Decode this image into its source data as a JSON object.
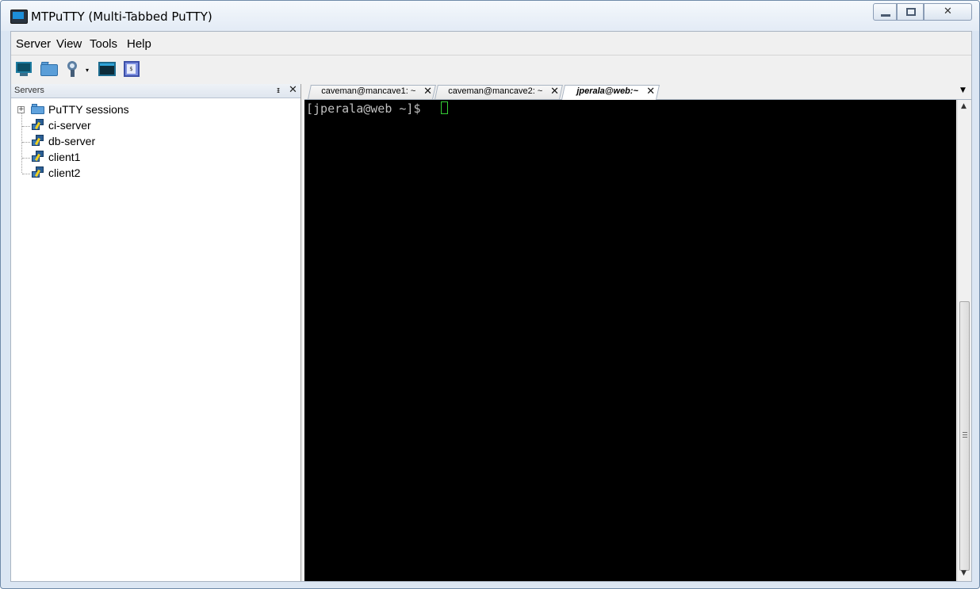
{
  "window": {
    "title": "MTPuTTY (Multi-Tabbed PuTTY)",
    "controls": {
      "minimize": "minimize",
      "maximize": "maximize",
      "close": "✕"
    }
  },
  "menu": [
    "Server",
    "View",
    "Tools",
    "Help"
  ],
  "toolbar": {
    "icons": [
      "new-session-icon",
      "open-folder-icon",
      "find-icon",
      "terminal-window-icon",
      "script-icon"
    ],
    "dropdown_glyph": "▾"
  },
  "servers_panel": {
    "title": "Servers",
    "pin_glyph": "ᵻ",
    "close_glyph": "✕",
    "tree": {
      "root": {
        "label": "PuTTY sessions",
        "expander": "+"
      },
      "sessions": [
        "ci-server",
        "db-server",
        "client1",
        "client2"
      ]
    }
  },
  "tabs": [
    {
      "label": "caveman@mancave1: ~",
      "active": false
    },
    {
      "label": "caveman@mancave2: ~",
      "active": false
    },
    {
      "label": "jperala@web:~",
      "active": true
    }
  ],
  "tab_close_glyph": "✕",
  "tab_menu_glyph": "▼",
  "terminal": {
    "prompt": "[jperala@web ~]$ ",
    "background": "#000000",
    "text_color": "#c0c0c0",
    "cursor_color": "#35d035"
  },
  "scrollbar": {
    "up": "▲",
    "down": "▼"
  }
}
